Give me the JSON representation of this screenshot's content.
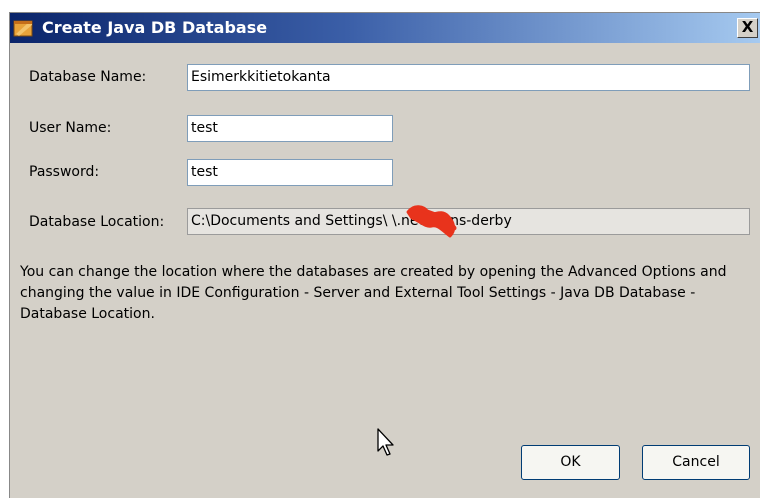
{
  "window": {
    "title": "Create Java DB Database",
    "close_glyph": "X"
  },
  "form": {
    "database_name": {
      "label": "Database Name:",
      "value": "Esimerkkitietokanta"
    },
    "user_name": {
      "label": "User Name:",
      "value": "test"
    },
    "password": {
      "label": "Password:",
      "value": "test"
    },
    "database_location": {
      "label": "Database Location:",
      "value": "C:\\Documents and Settings\\ \\.netbeans-derby"
    }
  },
  "info_text": "You can change the location where the databases are created by opening the Advanced Options and changing the value in IDE Configuration - Server and External Tool Settings - Java DB Database - Database Location.",
  "buttons": {
    "ok": "OK",
    "cancel": "Cancel"
  },
  "colors": {
    "title_gradient_start": "#0a246a",
    "title_gradient_end": "#a6caf0",
    "dialog_bg": "#d4d0c8",
    "redaction": "#e8331c"
  },
  "icons": {
    "title_icon": "java-coffee-icon",
    "cursor": "mouse-pointer-icon"
  }
}
